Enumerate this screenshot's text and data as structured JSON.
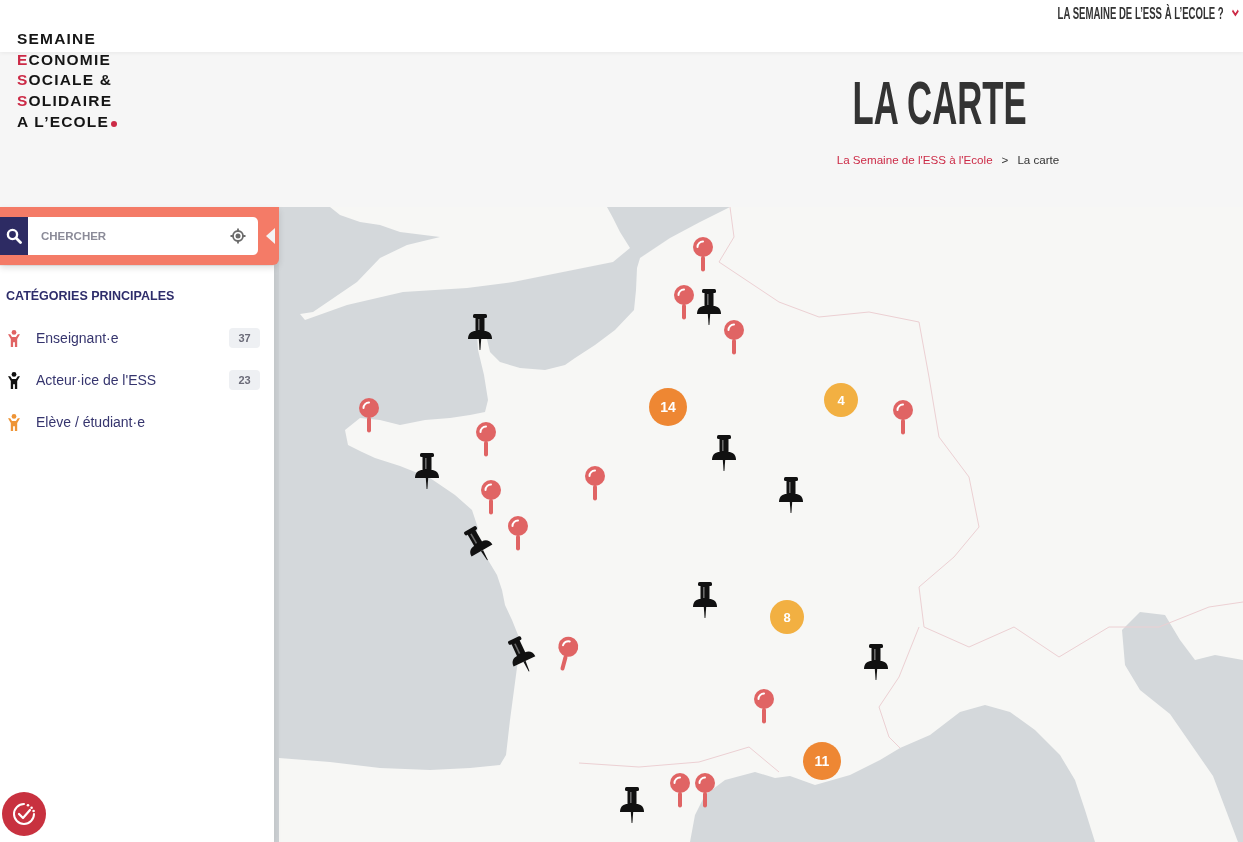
{
  "logo": {
    "lines": [
      {
        "text": "SEMAINE",
        "accent_initial": false
      },
      {
        "text": "ECONOMIE",
        "accent_initial": true
      },
      {
        "text": "SOCIALE &",
        "accent_initial": true
      },
      {
        "text": "SOLIDAIRE",
        "accent_initial": true
      },
      {
        "text": "A L’ECOLE",
        "accent_initial": false
      }
    ]
  },
  "top_nav": {
    "link": "LA SEMAINE DE L’ESS À L’ECOLE ?"
  },
  "page_header": {
    "title": "LA CARTE",
    "breadcrumb": [
      {
        "kind": "link",
        "label": "La Semaine de l'ESS à l'Ecole"
      },
      {
        "kind": "separator",
        "label": ">"
      },
      {
        "kind": "current",
        "label": "La carte"
      }
    ]
  },
  "sidebar": {
    "search": {
      "placeholder": "CHERCHER"
    },
    "categories": {
      "title": "CATÉGORIES PRINCIPALES",
      "items": [
        {
          "label": "Enseignant·e",
          "count": "37",
          "color": "#e06363"
        },
        {
          "label": "Acteur·ice de l'ESS",
          "count": "23",
          "color": "#111111"
        },
        {
          "label": "Elève / étudiant·e",
          "color": "#ee9436"
        }
      ]
    }
  },
  "map": {
    "markers": [
      {
        "kind": "pin"
      },
      {
        "kind": "pin"
      },
      {
        "kind": "pushpin"
      },
      {
        "kind": "pushpin"
      },
      {
        "kind": "pin"
      },
      {
        "kind": "pin"
      },
      {
        "kind": "pin"
      },
      {
        "kind": "pin"
      },
      {
        "kind": "pushpin"
      },
      {
        "kind": "pushpin"
      },
      {
        "kind": "pin"
      },
      {
        "kind": "pushpin"
      },
      {
        "kind": "pin"
      },
      {
        "kind": "pin"
      },
      {
        "kind": "pushpin"
      },
      {
        "kind": "pushpin"
      },
      {
        "kind": "pushpin"
      },
      {
        "kind": "pin"
      },
      {
        "kind": "pushpin"
      },
      {
        "kind": "pin"
      },
      {
        "kind": "pin"
      },
      {
        "kind": "pin"
      },
      {
        "kind": "pushpin"
      }
    ],
    "clusters": [
      {
        "count": "14",
        "color": "#ee8733"
      },
      {
        "count": "4",
        "color": "#f2b042"
      },
      {
        "count": "8",
        "color": "#f2b042"
      },
      {
        "count": "11",
        "color": "#ee8733"
      }
    ]
  }
}
